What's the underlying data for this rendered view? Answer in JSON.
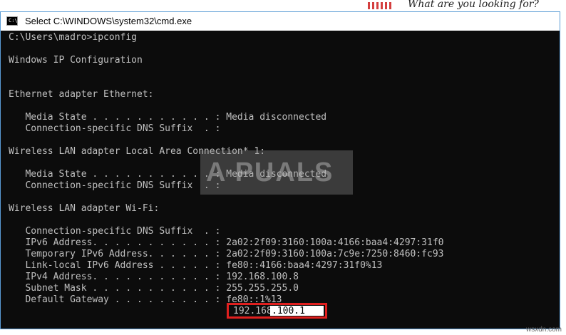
{
  "background_page": {
    "heading": "What are you looking for?"
  },
  "window": {
    "title": "Select C:\\WINDOWS\\system32\\cmd.exe",
    "icon_name": "cmd-console-icon",
    "icon_glyph": "C:\\"
  },
  "console": {
    "lines": [
      "C:\\Users\\madro>ipconfig",
      "",
      "Windows IP Configuration",
      "",
      "",
      "Ethernet adapter Ethernet:",
      "",
      "   Media State . . . . . . . . . . . : Media disconnected",
      "   Connection-specific DNS Suffix  . :",
      "",
      "Wireless LAN adapter Local Area Connection* 1:",
      "",
      "   Media State . . . . . . . . . . . : Media disconnected",
      "   Connection-specific DNS Suffix  . :",
      "",
      "Wireless LAN adapter Wi-Fi:",
      "",
      "   Connection-specific DNS Suffix  . :",
      "   IPv6 Address. . . . . . . . . . . : 2a02:2f09:3160:100a:4166:baa4:4297:31f0",
      "   Temporary IPv6 Address. . . . . . : 2a02:2f09:3160:100a:7c9e:7250:8460:fc93",
      "   Link-local IPv6 Address . . . . . : fe80::4166:baa4:4297:31f0%13",
      "   IPv4 Address. . . . . . . . . . . : 192.168.100.8",
      "   Subnet Mask . . . . . . . . . . . : 255.255.255.0",
      "   Default Gateway . . . . . . . . . : fe80::1%13"
    ]
  },
  "gateway_highlight": {
    "prefix": "192.168",
    "selected": ".100.1",
    "border_color": "#e0201f"
  },
  "watermark": {
    "text": "A PUALS"
  },
  "site_mark": "wsxdn.com"
}
